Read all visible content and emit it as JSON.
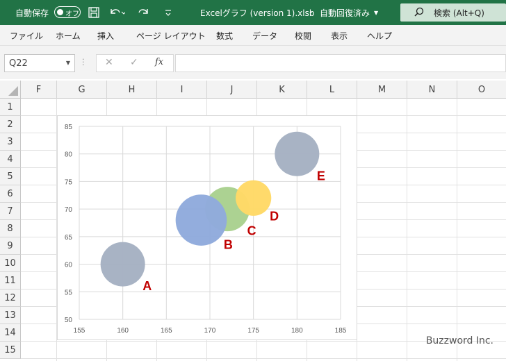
{
  "titlebar": {
    "autosave_label": "自動保存",
    "autosave_state": "オフ",
    "filename": "Excelグラフ (version 1).xlsb",
    "separator": "-",
    "save_status": "自動回復済み",
    "search_label": "検索 (Alt+Q)",
    "icons": [
      "save-icon",
      "undo-icon",
      "redo-icon",
      "customize-icon",
      "search-icon"
    ]
  },
  "ribbon": {
    "tabs": [
      "ファイル",
      "ホーム",
      "挿入",
      "ページ レイアウト",
      "数式",
      "データ",
      "校閲",
      "表示",
      "ヘルプ"
    ]
  },
  "formula_bar": {
    "name_box": "Q22",
    "cancel_icon": "✕",
    "enter_icon": "✓",
    "fx_label": "fx",
    "formula_value": ""
  },
  "grid": {
    "columns": [
      "F",
      "G",
      "H",
      "I",
      "J",
      "K",
      "L",
      "M",
      "N",
      "O"
    ],
    "rows": [
      "1",
      "2",
      "3",
      "4",
      "5",
      "6",
      "7",
      "8",
      "9",
      "10",
      "11",
      "12",
      "13",
      "14",
      "15"
    ]
  },
  "chart_data": {
    "type": "scatter",
    "subtype": "bubble",
    "title": "",
    "xlabel": "",
    "ylabel": "",
    "xlim": [
      155,
      185
    ],
    "ylim": [
      50,
      85
    ],
    "xticks": [
      155,
      160,
      165,
      170,
      175,
      180,
      185
    ],
    "yticks": [
      50,
      55,
      60,
      65,
      70,
      75,
      80,
      85
    ],
    "grid": true,
    "points": [
      {
        "label": "A",
        "x": 160,
        "y": 60,
        "size": 1.0,
        "color": "#a5b1c2"
      },
      {
        "label": "C",
        "x": 172,
        "y": 70,
        "size": 1.0,
        "color": "#a9d18e"
      },
      {
        "label": "D",
        "x": 175,
        "y": 72,
        "size": 0.8,
        "color": "#ffd966"
      },
      {
        "label": "B",
        "x": 169,
        "y": 68,
        "size": 1.15,
        "color": "#8faadc"
      },
      {
        "label": "E",
        "x": 180,
        "y": 80,
        "size": 1.0,
        "color": "#a5b1c2"
      }
    ],
    "label_color": "#c00000"
  },
  "watermark": "Buzzword Inc."
}
